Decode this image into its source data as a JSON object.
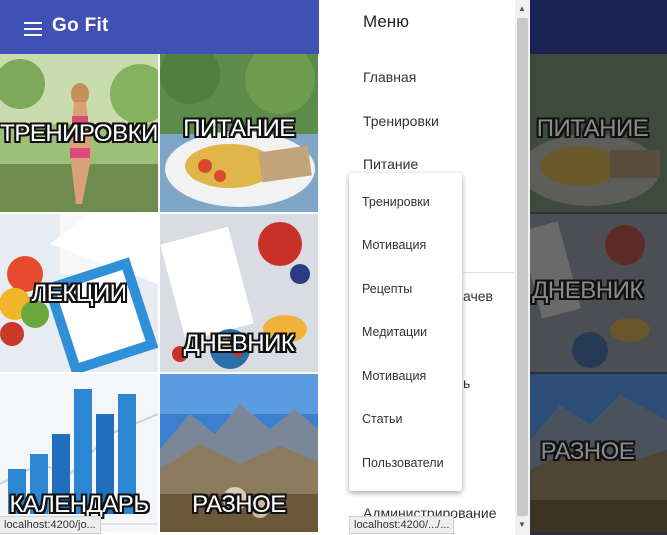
{
  "app": {
    "logo": "Go Fit"
  },
  "tiles": [
    {
      "label": "ТРЕНИРОВКИ"
    },
    {
      "label": "ПИТАНИЕ"
    },
    {
      "label": "ЛЕКЦИИ"
    },
    {
      "label": "ДНЕВНИК"
    },
    {
      "label": "КАЛЕНДАРЬ"
    },
    {
      "label": "РАЗНОЕ"
    }
  ],
  "status_url_left": "localhost:4200/jo...",
  "status_url_right": "localhost:4200/.../...",
  "drawer": {
    "title": "Меню",
    "items": [
      "Главная",
      "Тренировки",
      "Питание"
    ],
    "partial_items": [
      "ачев",
      "ь"
    ],
    "bottom_item": "Администрирование"
  },
  "submenu": {
    "items": [
      "Тренировки",
      "Мотивация",
      "Рецепты",
      "Медитации",
      "Мотивация",
      "Статьи",
      "Пользователи"
    ]
  },
  "colors": {
    "toolbar": "#3f51b5",
    "dim_toolbar": "#1a2353"
  },
  "icons": {
    "menu": "hamburger-icon",
    "logo": "wing-icon"
  }
}
